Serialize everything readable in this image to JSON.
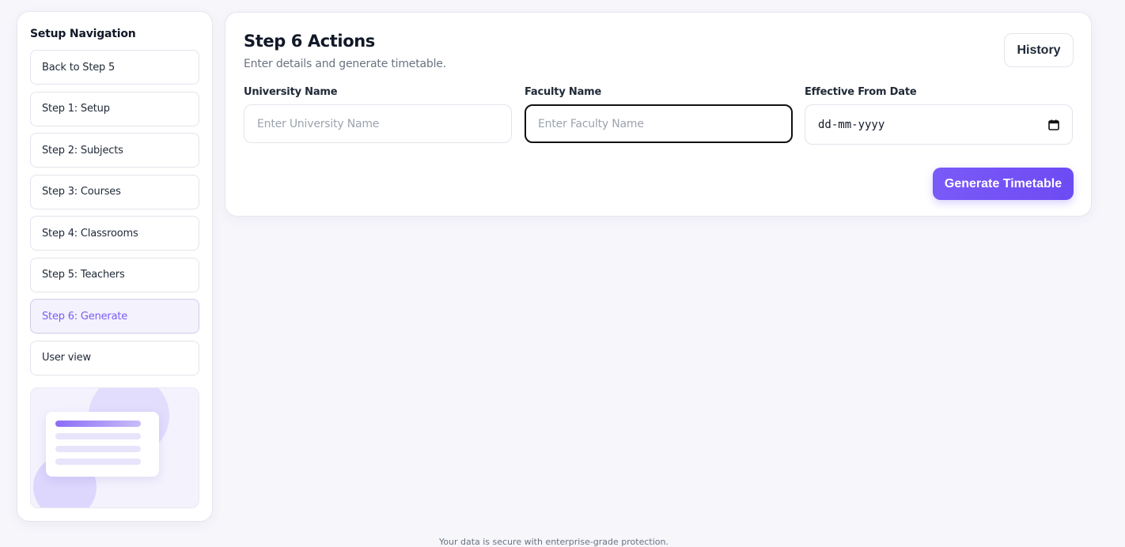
{
  "sidebar": {
    "title": "Setup Navigation",
    "items": [
      {
        "label": "Back to Step 5",
        "active": false
      },
      {
        "label": "Step 1: Setup",
        "active": false
      },
      {
        "label": "Step 2: Subjects",
        "active": false
      },
      {
        "label": "Step 3: Courses",
        "active": false
      },
      {
        "label": "Step 4: Classrooms",
        "active": false
      },
      {
        "label": "Step 5: Teachers",
        "active": false
      },
      {
        "label": "Step 6: Generate",
        "active": true
      },
      {
        "label": "User view",
        "active": false
      }
    ]
  },
  "main": {
    "title": "Step 6 Actions",
    "subtitle": "Enter details and generate timetable.",
    "history_label": "History",
    "fields": {
      "university": {
        "label": "University Name",
        "placeholder": "Enter University Name",
        "value": ""
      },
      "faculty": {
        "label": "Faculty Name",
        "placeholder": "Enter Faculty Name",
        "value": ""
      },
      "effective_date": {
        "label": "Effective From Date",
        "placeholder": "dd-mm-yyyy",
        "value": ""
      }
    },
    "generate_label": "Generate Timetable"
  },
  "footer": {
    "text": "Your data is secure with enterprise-grade protection."
  },
  "colors": {
    "accent": "#7c5cf5",
    "page_background": "#f6f6fb"
  },
  "icons": {
    "date_picker": "calendar-icon"
  }
}
